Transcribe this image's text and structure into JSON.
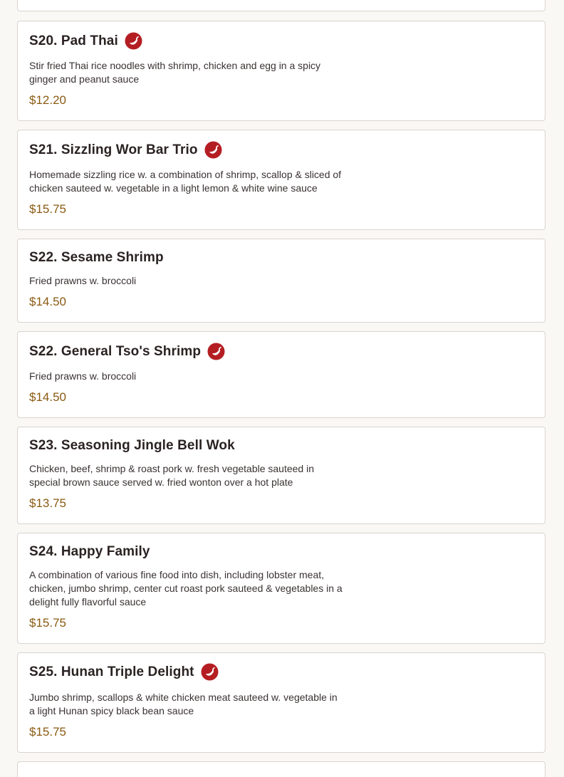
{
  "colors": {
    "page_background": "#faf8f5",
    "card_background": "#ffffff",
    "card_border": "#d9d4cd",
    "title_text": "#2b2222",
    "body_text": "#3a3232",
    "price_text": "#8a5a12",
    "spicy_icon": "#b41e23"
  },
  "items": [
    {
      "code_title": "S20. Pad Thai",
      "spicy": true,
      "spicy_icon": "chili-pepper-icon",
      "description": "Stir fried Thai rice noodles with shrimp, chicken and egg in a spicy ginger and peanut sauce",
      "price": "$12.20"
    },
    {
      "code_title": "S21. Sizzling Wor Bar Trio",
      "spicy": true,
      "spicy_icon": "chili-pepper-icon",
      "description": "Homemade sizzling rice w. a combination of shrimp, scallop & sliced of chicken sauteed w. vegetable in a light lemon & white wine sauce",
      "price": "$15.75"
    },
    {
      "code_title": "S22. Sesame Shrimp",
      "spicy": false,
      "description": "Fried prawns w. broccoli",
      "price": "$14.50"
    },
    {
      "code_title": "S22. General Tso's Shrimp",
      "spicy": true,
      "spicy_icon": "chili-pepper-icon",
      "description": "Fried prawns w. broccoli",
      "price": "$14.50"
    },
    {
      "code_title": "S23. Seasoning Jingle Bell Wok",
      "spicy": false,
      "description": "Chicken, beef, shrimp & roast pork w. fresh vegetable sauteed in special brown sauce served w. fried wonton over a hot plate",
      "price": "$13.75"
    },
    {
      "code_title": "S24. Happy Family",
      "spicy": false,
      "description": "A combination of various fine food into dish, including lobster meat, chicken, jumbo shrimp, center cut roast pork sauteed & vegetables in a delight fully flavorful sauce",
      "price": "$15.75"
    },
    {
      "code_title": "S25. Hunan Triple Delight",
      "spicy": true,
      "spicy_icon": "chili-pepper-icon",
      "description": "Jumbo shrimp, scallops & white chicken meat sauteed w. vegetable in a light Hunan spicy black bean sauce",
      "price": "$15.75"
    }
  ]
}
